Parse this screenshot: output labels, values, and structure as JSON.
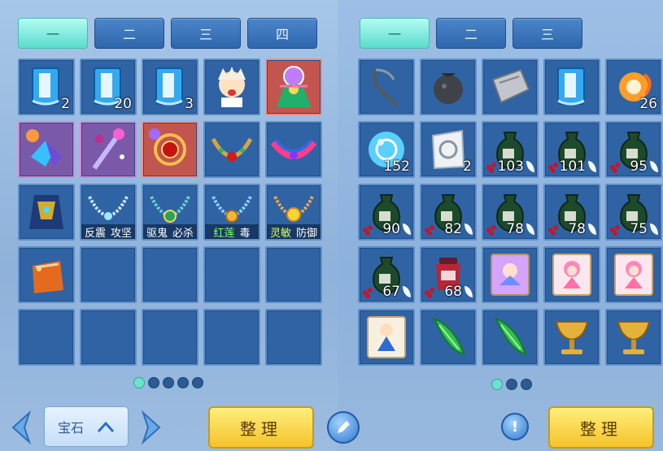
{
  "left": {
    "tabs": [
      {
        "label": "一",
        "active": true
      },
      {
        "label": "二",
        "active": false
      },
      {
        "label": "三",
        "active": false
      },
      {
        "label": "四",
        "active": false
      }
    ],
    "items": [
      {
        "icon": "blue-book-icon",
        "count": "2"
      },
      {
        "icon": "blue-book-icon",
        "count": "20"
      },
      {
        "icon": "blue-book-icon",
        "count": "3"
      },
      {
        "icon": "crying-chibi-icon",
        "count": ""
      },
      {
        "icon": "sorcerer-portrait-icon",
        "count": "",
        "frame": "red"
      },
      {
        "icon": "winged-boots-icon",
        "count": "",
        "frame": "pink"
      },
      {
        "icon": "magic-staff-icon",
        "count": "",
        "frame": "pink"
      },
      {
        "icon": "red-orb-ring-icon",
        "count": "",
        "frame": "red"
      },
      {
        "icon": "jeweled-necklace-icon",
        "count": ""
      },
      {
        "icon": "flame-collar-icon",
        "count": ""
      },
      {
        "icon": "dragon-armor-icon",
        "count": ""
      },
      {
        "icon": "pearl-necklace-icon",
        "tag": [
          "反震",
          "攻坚"
        ]
      },
      {
        "icon": "emerald-necklace-icon",
        "tag": [
          "驱鬼",
          "必杀"
        ]
      },
      {
        "icon": "gold-amulet-icon",
        "tag": [
          "红莲",
          "毒"
        ],
        "highlight": 0
      },
      {
        "icon": "sun-amulet-icon",
        "tag": [
          "灵敏",
          "防御"
        ],
        "highlight": 0,
        "hlclass": "hl2"
      },
      {
        "icon": "orange-pouch-icon",
        "count": ""
      },
      {},
      {},
      {},
      {},
      {},
      {},
      {},
      {},
      {}
    ],
    "pages": 5,
    "page_active": 0,
    "selector_label": "宝石",
    "sort_label": "整理"
  },
  "right": {
    "tabs": [
      {
        "label": "一",
        "active": true
      },
      {
        "label": "二",
        "active": false
      },
      {
        "label": "三",
        "active": false
      }
    ],
    "items": [
      {
        "icon": "slingshot-icon",
        "count": ""
      },
      {
        "icon": "black-pouch-icon",
        "count": ""
      },
      {
        "icon": "silver-ingot-icon",
        "count": ""
      },
      {
        "icon": "blue-book-icon",
        "count": ""
      },
      {
        "icon": "fire-swirl-icon",
        "count": "26"
      },
      {
        "icon": "blue-orb-icon",
        "count": "152"
      },
      {
        "icon": "paper-talisman-icon",
        "count": "2"
      },
      {
        "icon": "green-jar-icon",
        "count": "103",
        "leaf": true
      },
      {
        "icon": "green-jar-icon",
        "count": "101",
        "leaf": true
      },
      {
        "icon": "green-jar-icon",
        "count": "95",
        "leaf": true
      },
      {
        "icon": "green-jar-icon",
        "count": "90",
        "leaf": true
      },
      {
        "icon": "green-jar-icon",
        "count": "82",
        "leaf": true
      },
      {
        "icon": "green-jar-icon",
        "count": "78",
        "leaf": true
      },
      {
        "icon": "green-jar-icon",
        "count": "78",
        "leaf": true
      },
      {
        "icon": "green-jar-icon",
        "count": "75",
        "leaf": true
      },
      {
        "icon": "green-jar-icon",
        "count": "67",
        "leaf": true
      },
      {
        "icon": "red-jar-icon",
        "count": "68",
        "leaf": true
      },
      {
        "icon": "fairy-card-icon",
        "count": ""
      },
      {
        "icon": "pink-doll-card-icon",
        "count": ""
      },
      {
        "icon": "pink-doll-card-icon",
        "count": ""
      },
      {
        "icon": "boy-card-icon",
        "count": ""
      },
      {
        "icon": "green-melon-icon",
        "count": ""
      },
      {
        "icon": "green-melon-icon",
        "count": ""
      },
      {
        "icon": "golden-goblet-icon",
        "count": ""
      },
      {
        "icon": "golden-goblet-icon",
        "count": ""
      }
    ],
    "pages": 3,
    "page_active": 0,
    "sort_label": "整理"
  },
  "colors": {
    "accent": "#59dccb",
    "slot": "#2f63a3",
    "gold": "#f5c22b"
  }
}
